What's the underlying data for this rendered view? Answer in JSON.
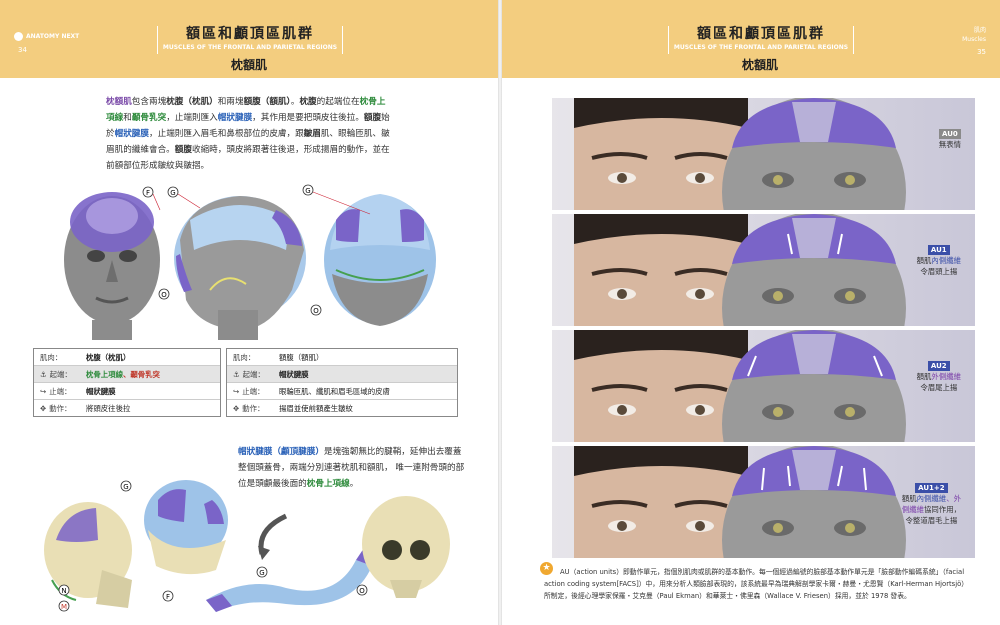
{
  "left": {
    "page_no": "34",
    "brand": "ANATOMY NEXT",
    "title_zh": "額區和顱頂區肌群",
    "title_en": "MUSCLES OF THE FRONTAL AND PARIETAL REGIONS",
    "subtitle": "枕額肌",
    "intro": [
      [
        "枕額肌",
        "p"
      ],
      [
        "包含兩塊",
        ""
      ],
      [
        "枕腹（枕肌）",
        "k"
      ],
      [
        "和兩塊",
        ""
      ],
      [
        "額腹（額肌）",
        "k"
      ],
      [
        "。",
        ""
      ],
      [
        "枕腹",
        "k"
      ],
      [
        "的起端位在",
        ""
      ],
      [
        "枕骨上項線",
        "g"
      ],
      [
        "和",
        ""
      ],
      [
        "顳骨乳突",
        "g"
      ],
      [
        "，止端則匯入",
        ""
      ],
      [
        "帽狀腱膜",
        "b"
      ],
      [
        "，其作用是要把頭皮往",
        ""
      ],
      [
        "後拉。",
        ""
      ],
      [
        "額腹",
        "k"
      ],
      [
        "始於",
        ""
      ],
      [
        "帽狀腱膜",
        "b"
      ],
      [
        "，止端則匯入眉毛和鼻根部位的皮膚，跟",
        ""
      ],
      [
        "皺眉",
        "k"
      ],
      [
        "肌、眼輪匝肌、皺眉肌的纖維會合。",
        ""
      ],
      [
        "額腹",
        "k"
      ],
      [
        "收縮時，頭皮將跟著往後退，",
        ""
      ],
      [
        "形成揚眉的動作，並在前額部位形成皺紋與皺摺。",
        ""
      ]
    ],
    "labels": {
      "f": "F",
      "g": "G",
      "o": "O",
      "n": "N",
      "m": "M"
    },
    "table1": {
      "muscle_k": "肌肉：",
      "muscle_v": "枕腹（枕肌）",
      "origin_k": "起端：",
      "origin_v1": "枕骨上項線",
      "origin_v2": "、顳骨乳突",
      "insert_k": "止端：",
      "insert_v": "帽狀腱膜",
      "action_k": "動作：",
      "action_v": "將頭皮往後拉"
    },
    "table2": {
      "muscle_k": "肌肉：",
      "muscle_v": "額腹（額肌）",
      "origin_k": "起端：",
      "origin_v": "帽狀腱膜",
      "insert_k": "止端：",
      "insert_v": "眼輪匝肌、纖肌和眉毛區域的皮膚",
      "action_k": "動作：",
      "action_v": "揚眉並使前額產生皺紋"
    },
    "para2": [
      [
        "帽狀腱膜（顱頂腱膜）",
        "b"
      ],
      [
        "是塊強韌無比的腱鞘，延伸出",
        ""
      ],
      [
        "去覆蓋整個頭蓋骨，兩端分別連著枕肌和額肌，  唯",
        ""
      ],
      [
        "一連附骨頭的部位是頭顱最後面的",
        ""
      ],
      [
        "枕骨上項線",
        "g"
      ],
      [
        "。",
        ""
      ]
    ]
  },
  "right": {
    "page_no": "35",
    "corner_zh": "肌肉",
    "corner_en": "Muscles",
    "title_zh": "額區和顱頂區肌群",
    "title_en": "MUSCLES OF THE FRONTAL AND PARIETAL REGIONS",
    "subtitle": "枕額肌",
    "au_panels": [
      {
        "tag": "AU0",
        "tag_color": "#8a8a8a",
        "lines": [
          "無表情"
        ]
      },
      {
        "tag": "AU1",
        "tag_color": "#3b4fa8",
        "line1_a": "額肌",
        "line1_b": "內側纖維",
        "line2": "令眉頭上揚"
      },
      {
        "tag": "AU2",
        "tag_color": "#3b4fa8",
        "line1_a": "額肌",
        "line1_b": "外側纖維",
        "line2": "令眉尾上揚"
      },
      {
        "tag": "AU1+2",
        "tag_color": "#3b4fa8",
        "line1_a": "額肌",
        "line1_b": "內側纖維",
        "line1_c": "、外",
        "line2_a": "側纖維",
        "line2_b": "協同作用，",
        "line3": "令整道眉毛上揚"
      }
    ],
    "note": "AU（action units）即動作單元，指個別肌肉或肌群的基本動作。每一個經過編號的臉部基本動作單元是「臉部動作編碼系統」（facial action coding system[FACS]）中，用來分析人類臉部表現的，該系統最早為瑞典解剖學家卡爾・赫曼・尤恩賢（Karl-Herman Hjortsjö）所制定，後經心理學家保羅・艾克曼（Paul Ekman）和華萊士・佛里森（Wallace V. Friesen）採用，並於 1978 發表。",
    "star": "★"
  },
  "colors": {
    "band": "#f3cd7f",
    "purple_muscle": "#7a64c8",
    "aponeurosis_blue": "#9fc6ee",
    "bone": "#e9dfb5"
  }
}
